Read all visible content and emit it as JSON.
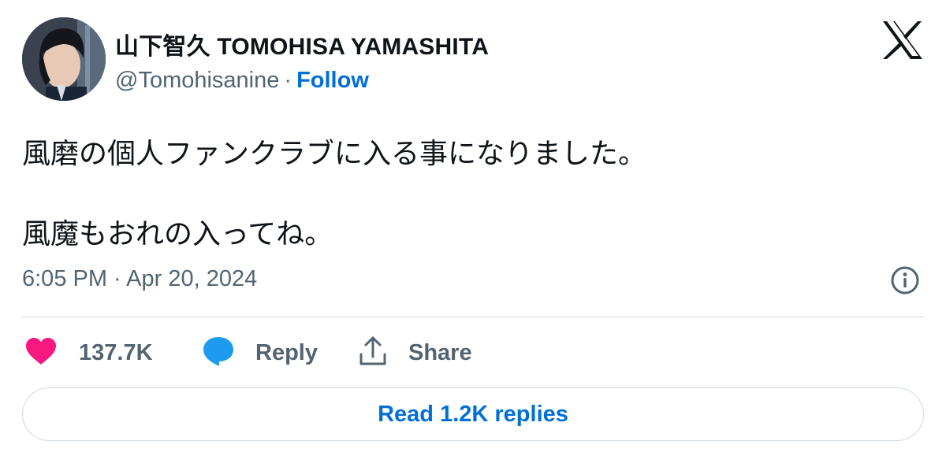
{
  "author": {
    "display_name": "山下智久 TOMOHISA YAMASHITA",
    "handle": "@Tomohisanine",
    "separator": "·",
    "follow_label": "Follow"
  },
  "tweet": {
    "line1": "風磨の個人ファンクラブに入る事になりました。",
    "line2": "風魔もおれの入ってね。",
    "timestamp": "6:05 PM · Apr 20, 2024"
  },
  "actions": {
    "like_count": "137.7K",
    "reply_label": "Reply",
    "share_label": "Share"
  },
  "read_replies_label": "Read 1.2K replies",
  "colors": {
    "text_primary": "#0f1419",
    "text_secondary": "#536471",
    "link_blue": "#006fd6",
    "like_pink": "#f91880",
    "reply_blue": "#1d9bf0",
    "border": "#cfd9de"
  },
  "icons": {
    "brand": "x-logo-icon",
    "info": "info-icon",
    "like": "heart-icon",
    "reply": "speech-bubble-icon",
    "share": "share-upload-icon"
  }
}
